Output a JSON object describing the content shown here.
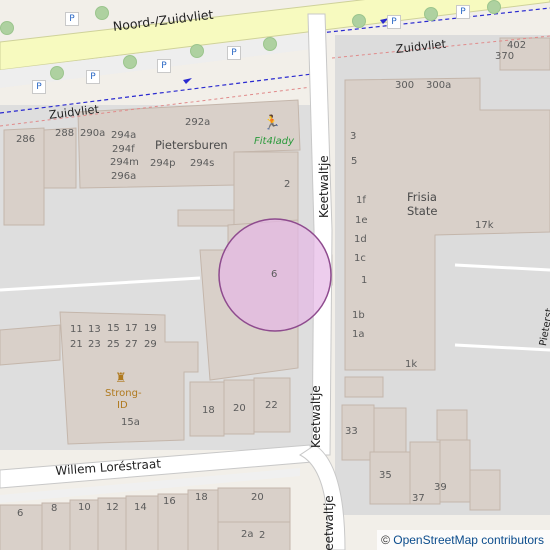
{
  "map": {
    "roads": {
      "noord_zuidvliet": "Noord-/Zuidvliet",
      "zuidvliet": "Zuidvliet",
      "keetwaltje_upper": "Keetwaltje",
      "keetwaltje_lower": "Keetwaltje",
      "keetwaltje_bottom": "Keetwaltje",
      "willem_lorestraat": "Willem Loréstraat",
      "pieter_partial": "Pieterst"
    },
    "places": {
      "pietersburen": "Pietersburen",
      "fit4lady": "Fit4lady",
      "frisia_line1": "Frisia",
      "frisia_line2": "State",
      "strong_line1": "Strong-",
      "strong_line2": "ID"
    },
    "parking_symbol": "P",
    "house_numbers": {
      "n402": "402",
      "n370": "370",
      "n300": "300",
      "n300a": "300a",
      "n286": "286",
      "n288": "288",
      "n290a": "290a",
      "n292a": "292a",
      "n294a": "294a",
      "n294f": "294f",
      "n294m": "294m",
      "n294p": "294p",
      "n294s": "294s",
      "n296a": "296a",
      "n2": "2",
      "n6": "6",
      "n3": "3",
      "n5": "5",
      "n1f": "1f",
      "n1e": "1e",
      "n1d": "1d",
      "n1c": "1c",
      "n1": "1",
      "n1b": "1b",
      "n1a": "1a",
      "n1k": "1k",
      "n17k": "17k",
      "n11": "11",
      "n13": "13",
      "n15": "15",
      "n17": "17",
      "n19": "19",
      "n21": "21",
      "n23": "23",
      "n25": "25",
      "n27": "27",
      "n29": "29",
      "n15a": "15a",
      "n18": "18",
      "n20": "20",
      "n22": "22",
      "n33": "33",
      "n35": "35",
      "n37": "37",
      "n39": "39",
      "b6": "6",
      "b8": "8",
      "b10": "10",
      "b12": "12",
      "b14": "14",
      "b16": "16",
      "b18": "18",
      "b20": "20",
      "b2a": "2a",
      "b2": "2"
    },
    "attribution": {
      "symbol": "©",
      "text": "OpenStreetMap contributors"
    },
    "colors": {
      "background": "#f2efe9",
      "building": "#d9d0c9",
      "building_edge": "#c4b6ab",
      "major_road": "#f7fabf",
      "minor_road": "#ffffff",
      "marker_fill": "#e6b8e6",
      "marker_stroke": "#8e4b8e",
      "link": "#0b4c8c"
    }
  }
}
